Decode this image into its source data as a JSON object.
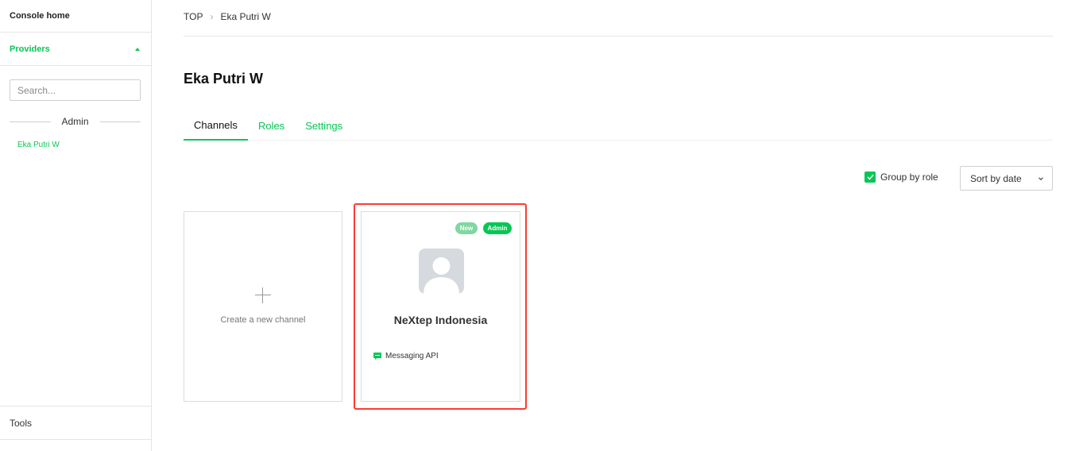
{
  "sidebar": {
    "console_home": "Console home",
    "providers_label": "Providers",
    "search_placeholder": "Search...",
    "divider_label": "Admin",
    "provider_item": "Eka Putri W",
    "tools_label": "Tools"
  },
  "breadcrumb": {
    "root": "TOP",
    "current": "Eka Putri W"
  },
  "page_title": "Eka Putri W",
  "tabs": [
    {
      "label": "Channels",
      "active": true
    },
    {
      "label": "Roles",
      "active": false
    },
    {
      "label": "Settings",
      "active": false
    }
  ],
  "controls": {
    "group_by_role_label": "Group by role",
    "group_by_role_checked": true,
    "sort_selected": "Sort by date"
  },
  "create_card": {
    "label": "Create a new channel"
  },
  "channels": [
    {
      "name": "NeXtep Indonesia",
      "type": "Messaging API",
      "badges": [
        "New",
        "Admin"
      ]
    }
  ],
  "colors": {
    "accent": "#06c755",
    "highlight": "#ff3b30"
  }
}
